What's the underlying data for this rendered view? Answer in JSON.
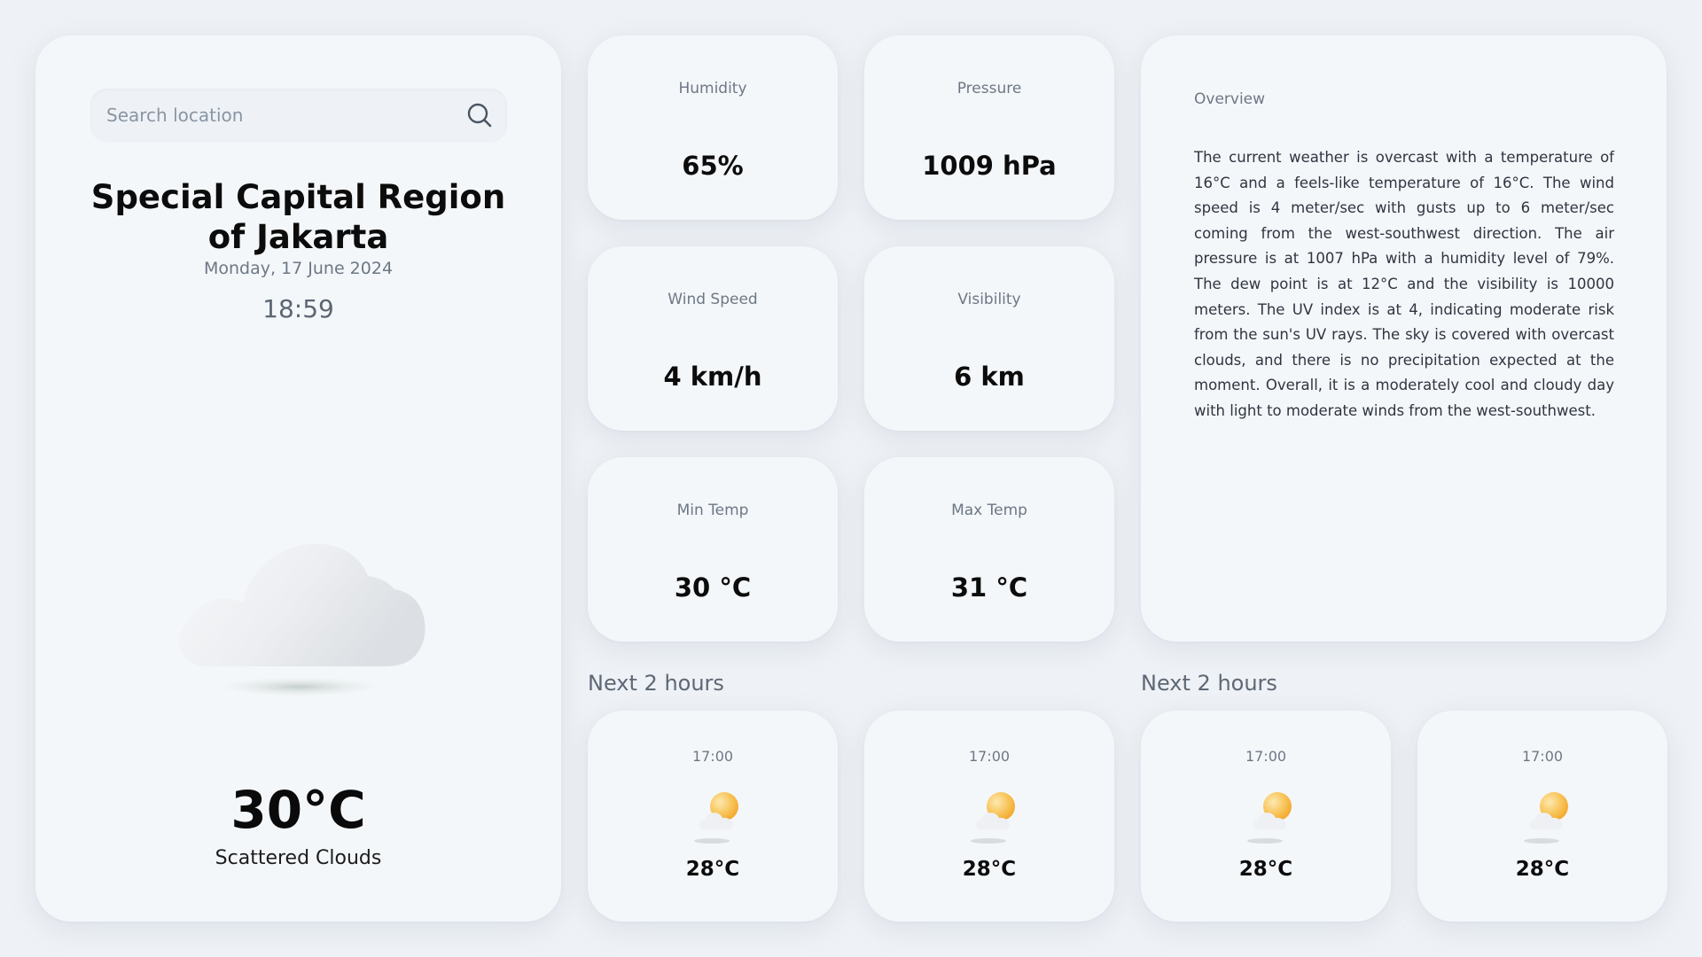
{
  "search": {
    "placeholder": "Search location",
    "value": ""
  },
  "location": {
    "city": "Special Capital Region of Jakarta",
    "date": "Monday, 17 June 2024",
    "time": "18:59"
  },
  "current": {
    "temperature": "30°C",
    "condition": "Scattered Clouds",
    "icon": "cloud-icon"
  },
  "stats": {
    "humidity": {
      "label": "Humidity",
      "value": "65%"
    },
    "pressure": {
      "label": "Pressure",
      "value": "1009 hPa"
    },
    "wind_speed": {
      "label": "Wind Speed",
      "value": "4 km/h"
    },
    "visibility": {
      "label": "Visibility",
      "value": "6 km"
    },
    "min_temp": {
      "label": "Min Temp",
      "value": "30 °C"
    },
    "max_temp": {
      "label": "Max Temp",
      "value": "31 °C"
    }
  },
  "overview": {
    "title": "Overview",
    "text": "The current weather is overcast with a temperature of 16°C and a feels-like temperature of 16°C. The wind speed is 4 meter/sec with gusts up to 6 meter/sec coming from the west-southwest direction. The air pressure is at 1007 hPa with a humidity level of 79%. The dew point is at 12°C and the visibility is 10000 meters. The UV index is at 4, indicating moderate risk from the sun's UV rays. The sky is covered with overcast clouds, and there is no precipitation expected at the moment. Overall, it is a moderately cool and cloudy day with light to moderate winds from the west-southwest."
  },
  "forecast": {
    "sections": [
      {
        "title": "Next 2 hours"
      },
      {
        "title": "Next 2 hours"
      }
    ],
    "hours": [
      {
        "time": "17:00",
        "temp": "28°C",
        "icon": "partly-cloudy-icon"
      },
      {
        "time": "17:00",
        "temp": "28°C",
        "icon": "partly-cloudy-icon"
      },
      {
        "time": "17:00",
        "temp": "28°C",
        "icon": "partly-cloudy-icon"
      },
      {
        "time": "17:00",
        "temp": "28°C",
        "icon": "partly-cloudy-icon"
      }
    ]
  },
  "colors": {
    "background": "#eef1f5",
    "card": "#f4f7fa",
    "sun": "#f8b63a",
    "muted_text": "#6d7784"
  }
}
